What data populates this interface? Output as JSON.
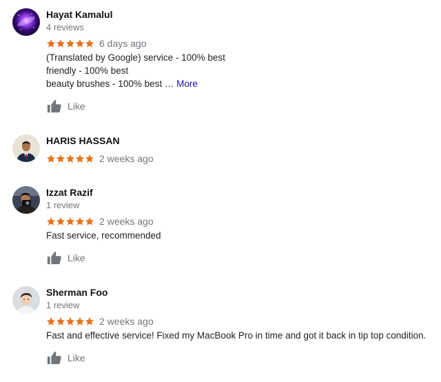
{
  "reviews": [
    {
      "name": "Hayat Kamalul",
      "review_count": "4 reviews",
      "rating": 5,
      "date": "6 days ago",
      "text_lines": [
        "(Translated by Google) service - 100% best",
        "friendly - 100% best",
        "beauty brushes - 100% best …"
      ],
      "more_label": "More",
      "like_label": "Like",
      "avatar_icon": "galaxy-avatar"
    },
    {
      "name": "HARIS HASSAN",
      "review_count": "",
      "rating": 5,
      "date": "2 weeks ago",
      "text_lines": [],
      "avatar_icon": "person-suit-avatar"
    },
    {
      "name": "Izzat Razif",
      "review_count": "1 review",
      "rating": 5,
      "date": "2 weeks ago",
      "text_lines": [
        "Fast service, recommended"
      ],
      "like_label": "Like",
      "avatar_icon": "person-camera-avatar"
    },
    {
      "name": "Sherman Foo",
      "review_count": "1 review",
      "rating": 5,
      "date": "2 weeks ago",
      "text_lines": [
        "Fast and effective service! Fixed my MacBook Pro in time and got it back in tip top condition."
      ],
      "like_label": "Like",
      "avatar_icon": "person-portrait-avatar"
    }
  ],
  "colors": {
    "star": "#e8711c",
    "muted": "#70757a",
    "link": "#1a0dab"
  }
}
